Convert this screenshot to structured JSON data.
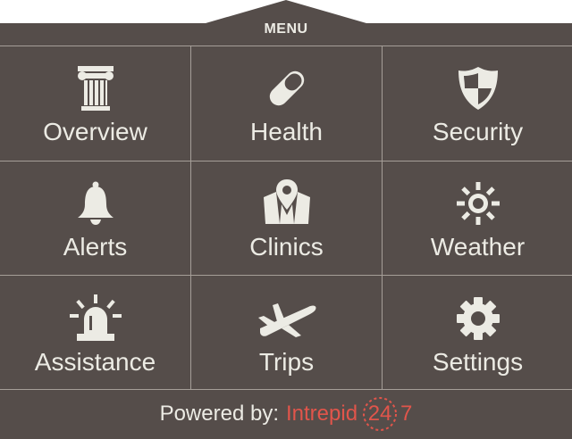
{
  "menu": {
    "title": "MENU"
  },
  "items": [
    {
      "label": "Overview",
      "icon": "pillar-icon"
    },
    {
      "label": "Health",
      "icon": "pill-icon"
    },
    {
      "label": "Security",
      "icon": "shield-icon"
    },
    {
      "label": "Alerts",
      "icon": "bell-icon"
    },
    {
      "label": "Clinics",
      "icon": "map-pin-icon"
    },
    {
      "label": "Weather",
      "icon": "sun-icon"
    },
    {
      "label": "Assistance",
      "icon": "siren-icon"
    },
    {
      "label": "Trips",
      "icon": "airplane-icon"
    },
    {
      "label": "Settings",
      "icon": "gear-icon"
    }
  ],
  "footer": {
    "powered_by": "Powered by:",
    "brand_name": "Intrepid",
    "brand_number": "24",
    "brand_suffix": "7"
  },
  "colors": {
    "panel": "#554d4a",
    "text": "#ecebe4",
    "divider": "#a59e98",
    "brand": "#e1554b"
  }
}
